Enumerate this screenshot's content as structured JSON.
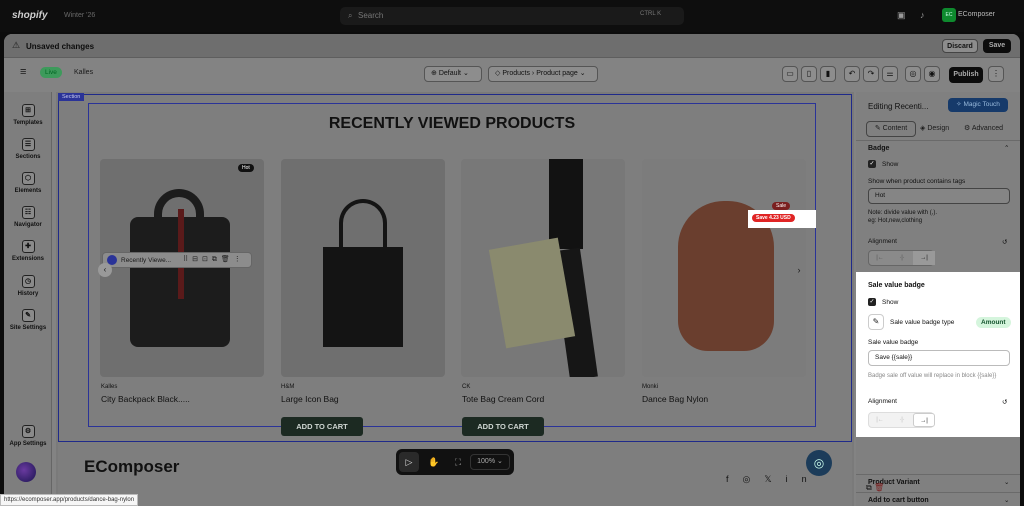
{
  "topbar": {
    "logo": "shopify",
    "store": "Winter '26",
    "search_placeholder": "Search",
    "shortcut": "CTRL K",
    "account_initials": "EC",
    "account_name": "EComposer"
  },
  "unsaved": {
    "label": "Unsaved changes",
    "discard": "Discard",
    "save": "Save"
  },
  "toolbar": {
    "live": "Live",
    "theme": "Kalles",
    "default": "Default",
    "breadcrumb_products": "Products",
    "breadcrumb_page": "Product page",
    "publish": "Publish"
  },
  "leftnav": {
    "items": [
      {
        "label": "Templates",
        "icon": "templates-icon"
      },
      {
        "label": "Sections",
        "icon": "sections-icon"
      },
      {
        "label": "Elements",
        "icon": "elements-icon"
      },
      {
        "label": "Navigator",
        "icon": "navigator-icon"
      },
      {
        "label": "Extensions",
        "icon": "extensions-icon"
      },
      {
        "label": "History",
        "icon": "history-icon"
      },
      {
        "label": "Site Settings",
        "icon": "site-settings-icon"
      }
    ],
    "app_settings": "App Settings"
  },
  "canvas": {
    "section_tag": "Section",
    "heading": "RECENTLY VIEWED PRODUCTS",
    "element_toolbar_label": "Recently Viewe...",
    "products": [
      {
        "brand": "Kalles",
        "name": "City Backpack Black.....",
        "badge": "Hot",
        "add": "ADD TO CART"
      },
      {
        "brand": "H&M",
        "name": "Large Icon Bag",
        "badge": "",
        "add": "ADD TO CART"
      },
      {
        "brand": "CK",
        "name": "Tote Bag Cream Cord",
        "badge": "",
        "add": "ADD TO CART"
      },
      {
        "brand": "Monki",
        "name": "Dance Bag Nylon",
        "badge": "Sale",
        "save": "Save 4.23 USD",
        "add": ""
      }
    ],
    "footer_logo": "EComposer",
    "zoom": "100%"
  },
  "rpanel": {
    "title": "Editing Recenti...",
    "magic": "Magic Touch",
    "tabs": [
      "Content",
      "Design",
      "Advanced"
    ],
    "badge": {
      "title": "Badge",
      "show": "Show",
      "tags_label": "Show when product contains tags",
      "tags_value": "Hot",
      "note": "Note: divide value with (,).",
      "example": "eg: Hot,new,clothing",
      "alignment": "Alignment"
    },
    "sale": {
      "title": "Sale value badge",
      "show": "Show",
      "type_label": "Sale value badge type",
      "type_value": "Amount",
      "field_label": "Sale value badge",
      "field_value": "Save {{sale}}",
      "help": "Badge sale off value will replace in block {{sale}}",
      "alignment": "Alignment"
    },
    "product_variant": "Product Variant",
    "add_to_cart_button": "Add to cart button"
  },
  "status_url": "https://ecomposer.app/products/dance-bag-nylon",
  "colors": {
    "accent": "#1f8a4c",
    "sale": "#e02424",
    "magic": "#1f8a4c"
  }
}
